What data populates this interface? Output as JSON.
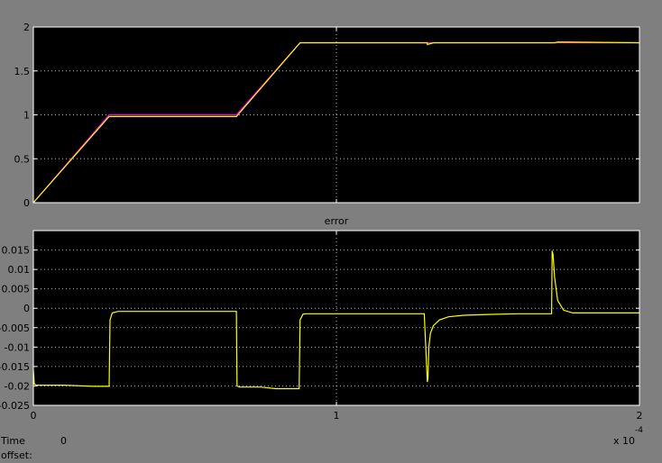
{
  "status_bar": {
    "time_offset_label": "Time offset:",
    "time_offset_value": "0",
    "x_multiplier": "x 10",
    "x_exponent": "-4"
  },
  "colors": {
    "background": "#7f7f7f",
    "plot_background": "#000000",
    "grid": "#ffffff",
    "reference_trace": "#ff00ff",
    "output_trace": "#ffff00",
    "error_trace": "#ffff00"
  },
  "chart_data": [
    {
      "type": "line",
      "title": "",
      "xlabel": "",
      "ylabel": "",
      "xlim": [
        0,
        2
      ],
      "ylim": [
        0,
        2
      ],
      "x_ticks": [
        "0",
        "1",
        "2"
      ],
      "y_ticks": [
        "0",
        "0.5",
        "1",
        "1.5",
        "2"
      ],
      "grid": true,
      "series": [
        {
          "color": "#ff00ff",
          "x": [
            0,
            0.25,
            0.67,
            0.88,
            2.0
          ],
          "y": [
            0,
            1,
            1,
            1.82,
            1.82
          ]
        },
        {
          "color": "#ffff00",
          "x": [
            0,
            0.25,
            0.67,
            0.88,
            1.3,
            1.3,
            1.32,
            1.72,
            1.73,
            2.0
          ],
          "y": [
            0,
            0.98,
            0.98,
            1.82,
            1.82,
            1.8,
            1.82,
            1.82,
            1.83,
            1.82
          ]
        }
      ]
    },
    {
      "type": "line",
      "title": "error",
      "xlabel": "",
      "ylabel": "",
      "xlim": [
        0,
        2
      ],
      "ylim": [
        -0.025,
        0.02
      ],
      "x_ticks": [
        "0",
        "1",
        "2"
      ],
      "y_ticks": [
        "0.015",
        "0.01",
        "0.005",
        "0",
        "-0.005",
        "-0.01",
        "-0.015",
        "-0.02",
        "-0.025"
      ],
      "grid": true,
      "series": [
        {
          "color": "#ffff00",
          "x": [
            0,
            0.003,
            0.01,
            0.1,
            0.2,
            0.25,
            0.253,
            0.26,
            0.28,
            0.3,
            0.67,
            0.672,
            0.68,
            0.75,
            0.8,
            0.877,
            0.88,
            0.89,
            0.9,
            1.0,
            1.2,
            1.29,
            1.3,
            1.302,
            1.305,
            1.31,
            1.32,
            1.34,
            1.37,
            1.42,
            1.5,
            1.6,
            1.71,
            1.712,
            1.715,
            1.72,
            1.73,
            1.75,
            1.78,
            2.0
          ],
          "y": [
            -0.016,
            -0.0195,
            -0.0198,
            -0.0198,
            -0.0201,
            -0.0201,
            -0.003,
            -0.0012,
            -0.0008,
            -0.0008,
            -0.0008,
            -0.02,
            -0.0203,
            -0.0203,
            -0.0207,
            -0.0207,
            -0.003,
            -0.0015,
            -0.0014,
            -0.0014,
            -0.0014,
            -0.0014,
            -0.019,
            -0.018,
            -0.01,
            -0.0065,
            -0.0045,
            -0.003,
            -0.0022,
            -0.0018,
            -0.0016,
            -0.0014,
            -0.0014,
            0.0148,
            0.0138,
            0.008,
            0.002,
            -0.0005,
            -0.0012,
            -0.0012
          ]
        }
      ]
    }
  ]
}
